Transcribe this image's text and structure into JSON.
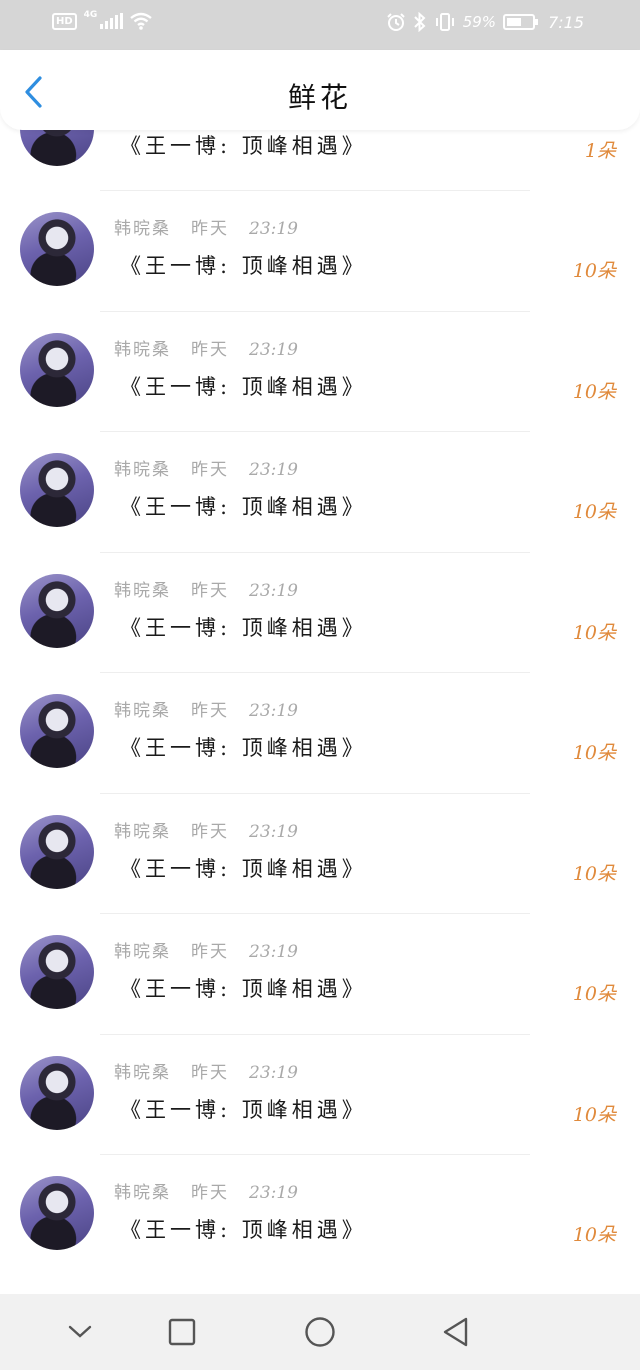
{
  "status_bar": {
    "hd_label": "HD",
    "network_label": "4G",
    "battery_percent": "59%",
    "battery_level": 0.59,
    "time": "7:15",
    "icons": [
      "signal-icon",
      "wifi-icon",
      "alarm-icon",
      "bluetooth-icon",
      "vibrate-icon",
      "battery-icon"
    ]
  },
  "header": {
    "title": "鲜花",
    "back_icon": "chevron-left-icon"
  },
  "colors": {
    "accent_back": "#2f8ee0",
    "count_orange": "#e08a3c",
    "meta_gray": "#a9a9a9"
  },
  "list": {
    "top_partial": {
      "gift": "《王一博: 顶峰相遇》",
      "count": "1朵"
    },
    "items": [
      {
        "name": "韩晥桑",
        "day": "昨天",
        "time": "23:19",
        "gift": "《王一博: 顶峰相遇》",
        "count": "10朵"
      },
      {
        "name": "韩晥桑",
        "day": "昨天",
        "time": "23:19",
        "gift": "《王一博: 顶峰相遇》",
        "count": "10朵"
      },
      {
        "name": "韩晥桑",
        "day": "昨天",
        "time": "23:19",
        "gift": "《王一博: 顶峰相遇》",
        "count": "10朵"
      },
      {
        "name": "韩晥桑",
        "day": "昨天",
        "time": "23:19",
        "gift": "《王一博: 顶峰相遇》",
        "count": "10朵"
      },
      {
        "name": "韩晥桑",
        "day": "昨天",
        "time": "23:19",
        "gift": "《王一博: 顶峰相遇》",
        "count": "10朵"
      },
      {
        "name": "韩晥桑",
        "day": "昨天",
        "time": "23:19",
        "gift": "《王一博: 顶峰相遇》",
        "count": "10朵"
      },
      {
        "name": "韩晥桑",
        "day": "昨天",
        "time": "23:19",
        "gift": "《王一博: 顶峰相遇》",
        "count": "10朵"
      },
      {
        "name": "韩晥桑",
        "day": "昨天",
        "time": "23:19",
        "gift": "《王一博: 顶峰相遇》",
        "count": "10朵"
      },
      {
        "name": "韩晥桑",
        "day": "昨天",
        "time": "23:19",
        "gift": "《王一博: 顶峰相遇》",
        "count": "10朵"
      }
    ]
  },
  "nav_bar": {
    "icons": [
      "collapse-chevron-icon",
      "recent-apps-square-icon",
      "home-circle-icon",
      "back-triangle-icon"
    ]
  }
}
